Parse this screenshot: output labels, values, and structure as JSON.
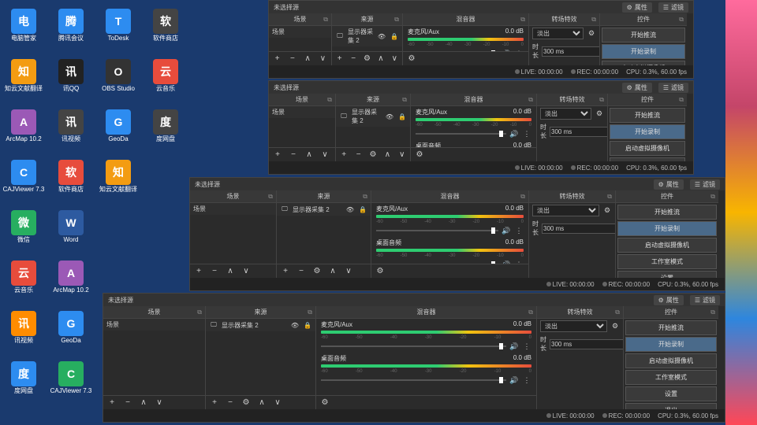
{
  "desktop": {
    "icons": [
      [
        {
          "l": "电脑管家",
          "c": "#2d8cf0"
        },
        {
          "l": "腾讯会议",
          "c": "#2d8cf0"
        },
        {
          "l": "ToDesk",
          "c": "#2d8cf0"
        },
        {
          "l": "软件商店",
          "c": "#444"
        }
      ],
      [
        {
          "l": "知云文献翻译",
          "c": "#f39c12"
        },
        {
          "l": "讯QQ",
          "c": "#222"
        },
        {
          "l": "OBS Studio",
          "c": "#333"
        },
        {
          "l": "云音乐",
          "c": "#e74c3c"
        }
      ],
      [
        {
          "l": "ArcMap 10.2",
          "c": "#9b59b6"
        },
        {
          "l": "讯视频",
          "c": "#444"
        },
        {
          "l": "GeoDa",
          "c": "#2d8cf0"
        },
        {
          "l": "度网盘",
          "c": "#444"
        }
      ],
      [
        {
          "l": "CAJViewer 7.3",
          "c": "#2d8cf0"
        },
        {
          "l": "软件商店",
          "c": "#e74c3c"
        },
        {
          "l": "知云文献翻译",
          "c": "#f39c12"
        },
        {
          "l": "",
          "c": ""
        }
      ],
      [
        {
          "l": "微信",
          "c": "#27ae60"
        },
        {
          "l": "Word",
          "c": "#2d5aa0"
        },
        {
          "l": "",
          "c": ""
        },
        {
          "l": "",
          "c": ""
        }
      ],
      [
        {
          "l": "云音乐",
          "c": "#e74c3c"
        },
        {
          "l": "ArcMap 10.2",
          "c": "#9b59b6"
        },
        {
          "l": "",
          "c": ""
        },
        {
          "l": "",
          "c": ""
        }
      ],
      [
        {
          "l": "讯视频",
          "c": "#ff8c00"
        },
        {
          "l": "GeoDa",
          "c": "#2d8cf0"
        },
        {
          "l": "",
          "c": ""
        },
        {
          "l": "",
          "c": ""
        }
      ],
      [
        {
          "l": "度网盘",
          "c": "#2d8cf0"
        },
        {
          "l": "CAJViewer 7.3",
          "c": "#27ae60"
        },
        {
          "l": "",
          "c": ""
        },
        {
          "l": "",
          "c": ""
        }
      ]
    ]
  },
  "obs": {
    "title_no_source": "未选择源",
    "prop_btn": "属性",
    "filter_btn": "滤镜",
    "panel_scene": "场景",
    "panel_source": "来源",
    "panel_mixer": "混音器",
    "panel_trans": "转场特效",
    "panel_ctrl": "控件",
    "scene_item": "场景",
    "source_item": "显示器采集 2",
    "mixer": {
      "ch1": {
        "name": "麦克风/Aux",
        "db": "0.0 dB"
      },
      "ch2": {
        "name": "桌面音频",
        "db": "0.0 dB"
      }
    },
    "trans": {
      "mode": "淡出",
      "dur_label": "时长",
      "dur_val": "300 ms"
    },
    "ctrl": {
      "stream": "开始推流",
      "record": "开始录制",
      "vcam": "启动虚拟摄像机",
      "studio": "工作室模式",
      "settings": "设置",
      "exit": "退出"
    },
    "status": {
      "live": "LIVE: 00:00:00",
      "rec": "REC: 00:00:00",
      "cpu": "CPU: 0.3%, 60.00 fps"
    }
  }
}
